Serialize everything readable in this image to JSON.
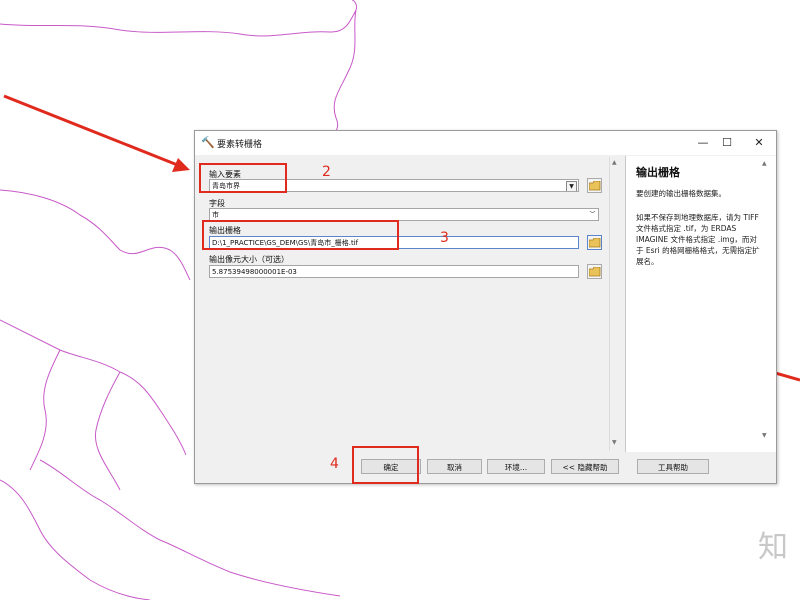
{
  "dialog": {
    "title": "要素转栅格",
    "window_controls": {
      "minimize": "—",
      "maximize": "☐",
      "close": "✕"
    }
  },
  "form": {
    "input_features": {
      "label": "输入要素",
      "value": "青岛市界"
    },
    "field": {
      "label": "字段",
      "value": "市"
    },
    "output_raster": {
      "label": "输出栅格",
      "value": "D:\\1_PRACTICE\\GS_DEM\\GS\\青岛市_栅格.tif"
    },
    "cell_size": {
      "label": "输出像元大小（可选）",
      "value": "5.87539498000001E-03"
    }
  },
  "help": {
    "title": "输出栅格",
    "paragraph1": "要创建的输出栅格数据集。",
    "paragraph2": "如果不保存到地理数据库，请为 TIFF 文件格式指定 .tif，为 ERDAS IMAGINE 文件格式指定 .img，而对于 Esri 的格网栅格格式，无需指定扩展名。"
  },
  "buttons": {
    "ok": "确定",
    "cancel": "取消",
    "environments": "环境...",
    "hide_help": "<< 隐藏帮助",
    "tool_help": "工具帮助"
  },
  "annotations": {
    "step2": "2",
    "step3": "3",
    "step4": "4"
  },
  "watermark": "知",
  "colors": {
    "annotation_red": "#e02a1d",
    "map_outline": "#c85ac8"
  },
  "icons": {
    "title": "hammer-icon",
    "browse": "folder-icon"
  }
}
